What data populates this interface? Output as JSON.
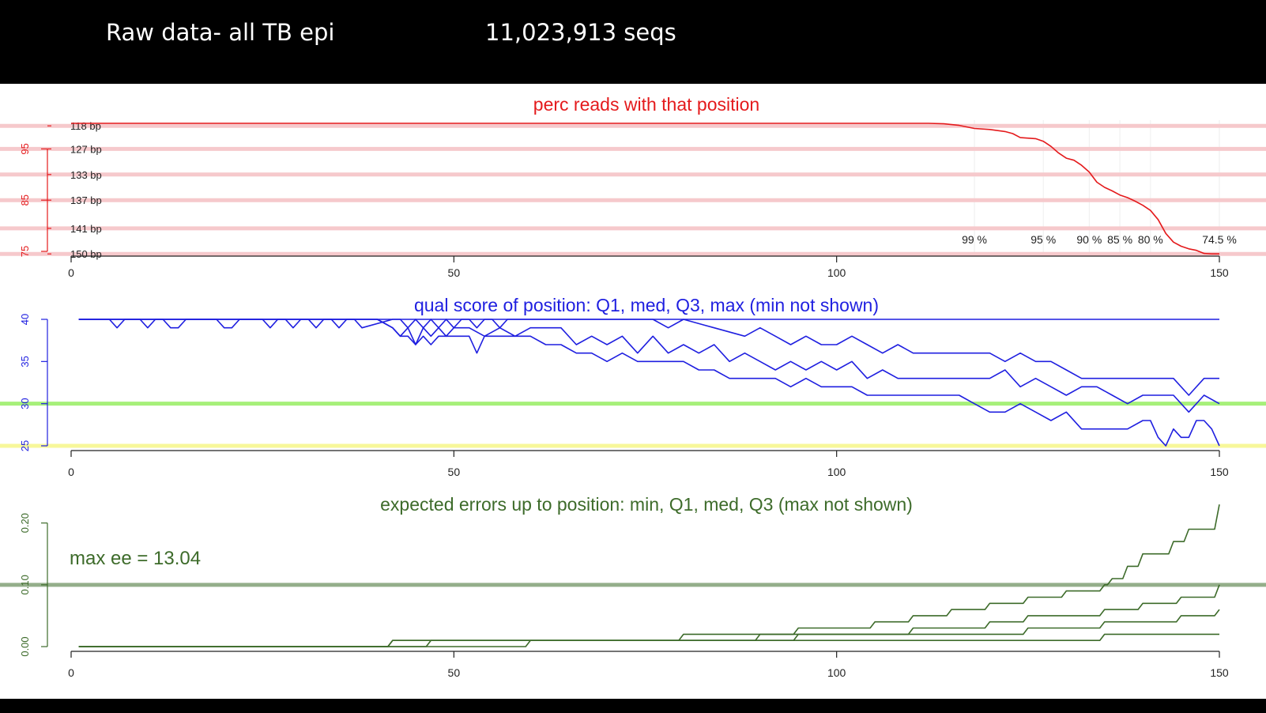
{
  "header": {
    "title": "Raw data- all TB epi",
    "seq_count": "11,023,913 seqs"
  },
  "colors": {
    "red": "#e41a1c",
    "pink": "#f6c9cc",
    "blue": "#1f1fe0",
    "green_band": "#a6f07a",
    "yellow_band": "#f7f79a",
    "dark_green": "#3d6b2a",
    "grid": "#eeeeee"
  },
  "x_ticks": [
    0,
    50,
    100,
    150
  ],
  "chart_data": [
    {
      "type": "line",
      "title": "perc reads with that position",
      "xlim": [
        0,
        150
      ],
      "ylim": [
        75,
        100
      ],
      "y_ticks": [
        75,
        85,
        95
      ],
      "reference_lines": [
        {
          "y": 99.5,
          "label": "118 bp"
        },
        {
          "y": 95,
          "label": "127 bp"
        },
        {
          "y": 90,
          "label": "133 bp"
        },
        {
          "y": 85,
          "label": "137 bp"
        },
        {
          "y": 79.5,
          "label": "141 bp"
        },
        {
          "y": 74.5,
          "label": "150 bp"
        }
      ],
      "percent_labels": [
        {
          "x": 118,
          "label": "99 %"
        },
        {
          "x": 127,
          "label": "95 %"
        },
        {
          "x": 133,
          "label": "90 %"
        },
        {
          "x": 137,
          "label": "85 %"
        },
        {
          "x": 141,
          "label": "80 %"
        },
        {
          "x": 150,
          "label": "74.5 %"
        }
      ],
      "vertical_grid_x": [
        118,
        127,
        133,
        137,
        141,
        150
      ],
      "series": [
        {
          "x": [
            0,
            112,
            114,
            116,
            118,
            120,
            122,
            123,
            124,
            126,
            127,
            128,
            129,
            130,
            131,
            132,
            133,
            134,
            135,
            136,
            137,
            138,
            139,
            140,
            141,
            142,
            143,
            144,
            145,
            146,
            147,
            148,
            149,
            150
          ],
          "y": [
            100,
            100,
            99.9,
            99.6,
            99,
            98.8,
            98.4,
            98,
            97.2,
            97,
            96.5,
            95.5,
            94.2,
            93.2,
            92.8,
            91.8,
            90.5,
            88.5,
            87.5,
            86.8,
            86,
            85.5,
            84.8,
            84,
            83,
            81.2,
            78.5,
            76.8,
            76,
            75.5,
            75.2,
            74.6,
            74.5,
            74.5
          ]
        }
      ]
    },
    {
      "type": "line",
      "title": "qual score of position: Q1, med, Q3, max (min not shown)",
      "xlim": [
        0,
        150
      ],
      "ylim": [
        25,
        40
      ],
      "y_ticks": [
        25,
        30,
        35,
        40
      ],
      "bands": [
        {
          "y": 30,
          "color": "green"
        },
        {
          "y": 25,
          "color": "yellow"
        }
      ],
      "series": [
        {
          "name": "max",
          "x": [
            1,
            150
          ],
          "y": [
            40,
            40
          ]
        },
        {
          "name": "Q3",
          "x": [
            1,
            5,
            6,
            7,
            9,
            10,
            11,
            12,
            13,
            14,
            15,
            16,
            19,
            20,
            21,
            22,
            25,
            26,
            27,
            28,
            29,
            30,
            31,
            32,
            33,
            34,
            35,
            36,
            37,
            38,
            42,
            43,
            44,
            45,
            46,
            47,
            48,
            49,
            50,
            51,
            52,
            53,
            54,
            55,
            56,
            57,
            58,
            60,
            62,
            64,
            66,
            68,
            70,
            72,
            74,
            76,
            78,
            80,
            84,
            88,
            90,
            92,
            94,
            96,
            98,
            100,
            102,
            104,
            106,
            108,
            110,
            112,
            114,
            116,
            118,
            120,
            122,
            124,
            126,
            128,
            130,
            132,
            134,
            136,
            138,
            140,
            142,
            144,
            146,
            148,
            150
          ],
          "y": [
            40,
            40,
            39,
            40,
            40,
            39,
            40,
            40,
            39,
            39,
            40,
            40,
            40,
            39,
            39,
            40,
            40,
            39,
            40,
            40,
            39,
            40,
            40,
            39,
            40,
            40,
            39,
            40,
            40,
            39,
            40,
            40,
            39,
            40,
            39,
            40,
            39,
            40,
            39,
            40,
            40,
            39,
            40,
            40,
            39,
            40,
            40,
            40,
            40,
            40,
            40,
            40,
            40,
            40,
            40,
            40,
            39,
            40,
            39,
            38,
            39,
            38,
            37,
            38,
            37,
            37,
            38,
            37,
            36,
            37,
            36,
            36,
            36,
            36,
            36,
            36,
            35,
            36,
            35,
            35,
            34,
            33,
            33,
            33,
            33,
            33,
            33,
            33,
            31,
            33,
            33
          ]
        },
        {
          "name": "med",
          "x": [
            1,
            40,
            42,
            43,
            44,
            45,
            46,
            47,
            48,
            49,
            50,
            52,
            54,
            56,
            58,
            60,
            64,
            66,
            68,
            70,
            72,
            74,
            76,
            78,
            80,
            82,
            84,
            86,
            88,
            90,
            92,
            94,
            96,
            98,
            100,
            102,
            104,
            106,
            108,
            110,
            112,
            114,
            116,
            118,
            120,
            122,
            124,
            126,
            128,
            130,
            132,
            134,
            136,
            138,
            140,
            142,
            144,
            146,
            148,
            150
          ],
          "y": [
            40,
            40,
            39,
            38,
            39,
            37,
            39,
            38,
            39,
            38,
            39,
            39,
            38,
            39,
            38,
            39,
            39,
            37,
            38,
            37,
            38,
            36,
            38,
            36,
            37,
            36,
            37,
            35,
            36,
            35,
            34,
            35,
            34,
            35,
            34,
            35,
            33,
            34,
            33,
            33,
            33,
            33,
            33,
            33,
            33,
            34,
            32,
            33,
            32,
            31,
            32,
            32,
            31,
            30,
            31,
            31,
            31,
            29,
            31,
            30
          ]
        },
        {
          "name": "Q1",
          "x": [
            1,
            40,
            42,
            43,
            44,
            45,
            46,
            47,
            48,
            50,
            52,
            53,
            54,
            56,
            58,
            60,
            62,
            64,
            66,
            68,
            70,
            72,
            74,
            76,
            78,
            80,
            82,
            84,
            86,
            88,
            90,
            92,
            94,
            96,
            98,
            100,
            102,
            104,
            106,
            108,
            110,
            112,
            114,
            116,
            118,
            120,
            122,
            124,
            126,
            128,
            130,
            132,
            134,
            136,
            138,
            140,
            141,
            142,
            143,
            144,
            145,
            146,
            147,
            148,
            149,
            150
          ],
          "y": [
            40,
            40,
            39,
            38,
            38,
            37,
            38,
            37,
            38,
            38,
            38,
            36,
            38,
            38,
            38,
            38,
            37,
            37,
            36,
            36,
            35,
            36,
            35,
            35,
            35,
            35,
            34,
            34,
            33,
            33,
            33,
            33,
            32,
            33,
            32,
            32,
            32,
            31,
            31,
            31,
            31,
            31,
            31,
            31,
            30,
            29,
            29,
            30,
            29,
            28,
            29,
            27,
            27,
            27,
            27,
            28,
            28,
            26,
            25,
            27,
            26,
            26,
            28,
            28,
            27,
            25
          ]
        }
      ]
    },
    {
      "type": "line",
      "title": "expected errors up to position: min, Q1, med, Q3 (max not shown)",
      "annotation": "max ee = 13.04",
      "xlim": [
        0,
        150
      ],
      "ylim": [
        0,
        0.22
      ],
      "y_ticks": [
        0.0,
        0.1,
        0.2
      ],
      "y_tick_labels": [
        "0.00",
        "0.10",
        "0.20"
      ],
      "bands": [
        {
          "y": 0.1,
          "color": "dark_green"
        }
      ],
      "series": [
        {
          "name": "min",
          "x": [
            1,
            50,
            60,
            70,
            80,
            90,
            100,
            110,
            120,
            125,
            130,
            133,
            135,
            140,
            145,
            150
          ],
          "y": [
            0,
            0,
            0.01,
            0.01,
            0.01,
            0.01,
            0.01,
            0.01,
            0.01,
            0.01,
            0.01,
            0.01,
            0.02,
            0.02,
            0.02,
            0.02
          ]
        },
        {
          "name": "Q1",
          "x": [
            1,
            45,
            47,
            52,
            60,
            70,
            80,
            90,
            95,
            100,
            105,
            110,
            115,
            120,
            125,
            130,
            135,
            140,
            145,
            150
          ],
          "y": [
            0,
            0,
            0.01,
            0.01,
            0.01,
            0.01,
            0.01,
            0.01,
            0.02,
            0.02,
            0.02,
            0.02,
            0.02,
            0.02,
            0.03,
            0.03,
            0.04,
            0.04,
            0.05,
            0.06
          ]
        },
        {
          "name": "med",
          "x": [
            1,
            40,
            42,
            45,
            55,
            60,
            70,
            78,
            80,
            85,
            90,
            95,
            100,
            105,
            110,
            115,
            120,
            125,
            130,
            135,
            140,
            145,
            150
          ],
          "y": [
            0,
            0,
            0.01,
            0.01,
            0.01,
            0.01,
            0.01,
            0.01,
            0.02,
            0.02,
            0.02,
            0.02,
            0.02,
            0.02,
            0.03,
            0.03,
            0.04,
            0.05,
            0.05,
            0.06,
            0.07,
            0.08,
            0.1
          ]
        },
        {
          "name": "Q3",
          "x": [
            1,
            40,
            42,
            50,
            60,
            70,
            80,
            90,
            95,
            100,
            105,
            110,
            115,
            120,
            125,
            130,
            135,
            136,
            138,
            140,
            142,
            144,
            146,
            148,
            150
          ],
          "y": [
            0,
            0,
            0.01,
            0.01,
            0.01,
            0.01,
            0.01,
            0.02,
            0.03,
            0.03,
            0.04,
            0.05,
            0.06,
            0.07,
            0.08,
            0.09,
            0.1,
            0.11,
            0.13,
            0.15,
            0.15,
            0.17,
            0.19,
            0.19,
            0.23
          ]
        }
      ]
    }
  ]
}
